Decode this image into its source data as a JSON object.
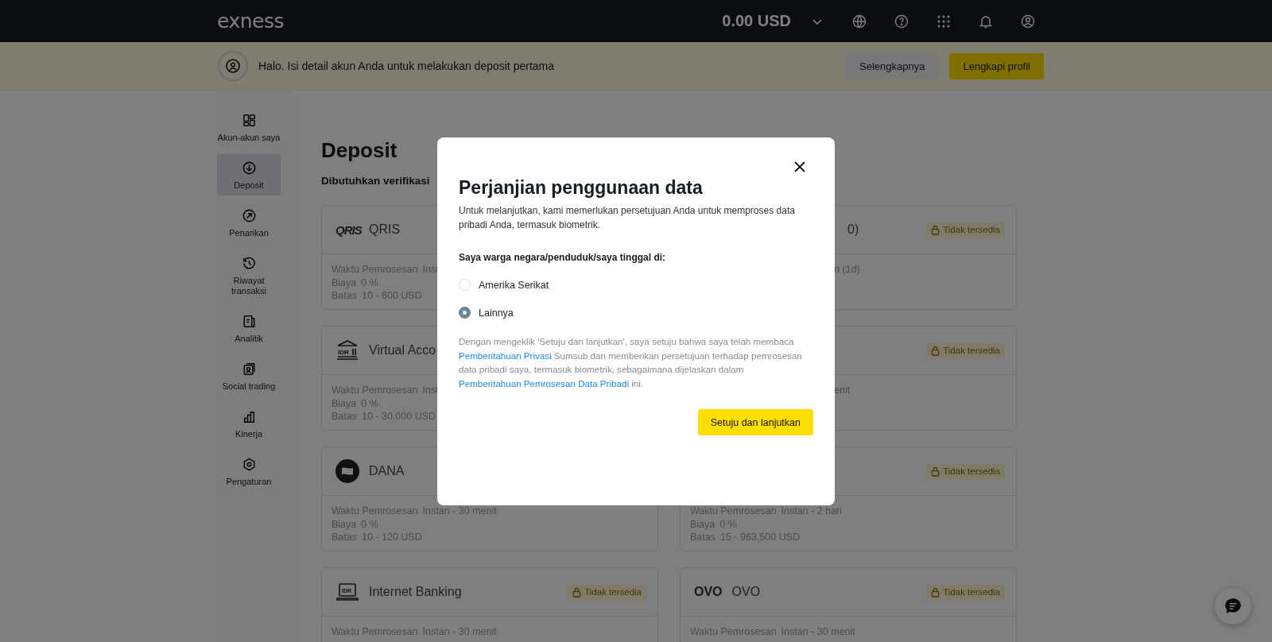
{
  "topbar": {
    "logo": "exness",
    "balance": "0.00 USD"
  },
  "banner": {
    "text": "Halo. Isi detail akun Anda untuk melakukan deposit pertama",
    "buttons": [
      {
        "label": "Selengkapnya",
        "kind": "secondary"
      },
      {
        "label": "Lengkapi profil",
        "kind": "primary"
      }
    ]
  },
  "sidebar": {
    "items": [
      {
        "label": "Akun-akun saya",
        "selected": false
      },
      {
        "label": "Deposit",
        "selected": true
      },
      {
        "label": "Penarikan",
        "selected": false
      },
      {
        "label": "Riwayat transaksi",
        "selected": false
      },
      {
        "label": "Analitik",
        "selected": false
      },
      {
        "label": "Social trading",
        "selected": false
      },
      {
        "label": "Kinerja",
        "selected": false
      },
      {
        "label": "Pengaturan",
        "selected": false
      }
    ]
  },
  "main": {
    "title": "Deposit",
    "subtitle": "Dibutuhkan verifikasi",
    "cards": [
      {
        "kind": "qris",
        "icon_text": "QRIS",
        "title": "QRIS",
        "cut": false,
        "rows": [
          {
            "label": "Waktu Pemrosesan",
            "value": "Inst"
          },
          {
            "label": "Biaya",
            "value": "0 %"
          },
          {
            "label": "Batas",
            "value": "10 - 600 USD"
          }
        ]
      },
      {
        "title": "0)",
        "cut": true,
        "badge": "Tidak tersedia",
        "rows": [
          {
            "value": "ri (1d)"
          }
        ]
      },
      {
        "kind": "bank",
        "icon_text": "IDR",
        "title": "Virtual Acco",
        "cut": false,
        "rows": [
          {
            "label": "Waktu Pemrosesan",
            "value": "Inst"
          },
          {
            "label": "Biaya",
            "value": "0 %"
          },
          {
            "label": "Batas",
            "value": "10 - 30,000 USD"
          }
        ]
      },
      {
        "cut": true,
        "badge": "Tidak tersedia",
        "rows": [
          {
            "value": "enit"
          }
        ]
      },
      {
        "kind": "wallet",
        "title": "DANA",
        "cut": false,
        "rows": [
          {
            "label": "Waktu Pemrosesan",
            "value": "Instan - 30 menit"
          },
          {
            "label": "Biaya",
            "value": "0 %"
          },
          {
            "label": "Batas",
            "value": "10 - 120 USD"
          }
        ]
      },
      {
        "cut": false,
        "badge": "Tidak tersedia",
        "rows": [
          {
            "label": "Waktu Pemrosesan",
            "value": "Instan - 2 hari"
          },
          {
            "label": "Biaya",
            "value": "0 %"
          },
          {
            "label": "Batas",
            "value": "15 - 963,500 USD"
          }
        ]
      },
      {
        "kind": "laptop",
        "icon_text": "IDR",
        "title": "Internet Banking",
        "cut": false,
        "badge": "Tidak tersedia",
        "rows": [
          {
            "label": "Waktu Pemrosesan",
            "value": "Instan - 30 menit"
          }
        ]
      },
      {
        "kind": "wordmark",
        "icon_text": "OVO",
        "title": "OVO",
        "cut": false,
        "badge": "Tidak tersedia",
        "rows": [
          {
            "label": "Waktu Pemrosesan",
            "value": "Instan - 30 menit"
          }
        ]
      }
    ]
  },
  "modal": {
    "title": "Perjanjian penggunaan data",
    "intro": "Untuk melanjutkan, kami memerlukan persetujuan Anda untuk memproses data pribadi Anda, termasuk biometrik.",
    "question": "Saya warga negara/penduduk/saya tinggal di:",
    "options": [
      {
        "label": "Amerika Serikat",
        "selected": false
      },
      {
        "label": "Lainnya",
        "selected": true
      }
    ],
    "consent": [
      {
        "kind": "text",
        "text": "Dengan mengeklik 'Setuju dan lanjutkan', saya setuju bahwa saya telah membaca "
      },
      {
        "kind": "link",
        "text": "Pemberitahuan Privasi"
      },
      {
        "kind": "text",
        "text": " Sumsub dan memberikan persetujuan terhadap pemrosesan data pribadi saya, termasuk biometrik, sebagaimana dijelaskan dalam "
      },
      {
        "kind": "link",
        "text": "Pemberitahuan Pemrosesan Data Pribadi"
      },
      {
        "kind": "text",
        "text": " ini."
      }
    ],
    "button": "Setuju dan lanjutkan"
  }
}
